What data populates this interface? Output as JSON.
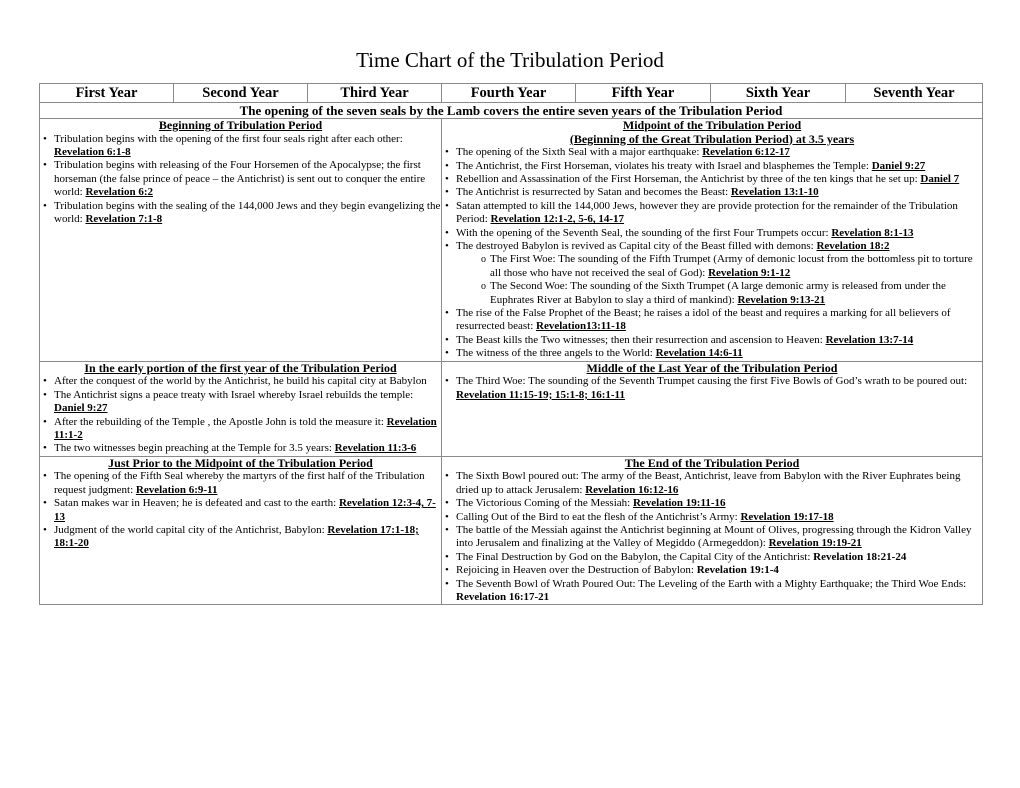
{
  "title": "Time Chart of the Tribulation Period",
  "years": [
    "First Year",
    "Second Year",
    "Third Year",
    "Fourth Year",
    "Fifth Year",
    "Sixth Year",
    "Seventh Year"
  ],
  "banner": "The opening of the seven seals by the Lamb covers the entire seven years of the Tribulation Period",
  "beginning": {
    "heading": "Beginning of Tribulation Period",
    "items": [
      {
        "text": "Tribulation begins with the opening of the first four seals right after each other: ",
        "ref": "Revelation 6:1-8"
      },
      {
        "text": "Tribulation begins with releasing of the Four Horsemen of the Apocalypse; the first horseman (the false prince of peace – the Antichrist) is sent out to conquer the entire world: ",
        "ref": "Revelation 6:2"
      },
      {
        "text": "Tribulation begins with the sealing of the 144,000 Jews and they begin evangelizing the world: ",
        "ref": "Revelation 7:1-8"
      }
    ]
  },
  "midpoint": {
    "heading": "Midpoint of the Tribulation Period",
    "subheading": "(Beginning of the Great Tribulation Period) at 3.5 years",
    "items": [
      {
        "text": "The opening of the Sixth Seal with a major earthquake: ",
        "ref": "Revelation 6:12-17"
      },
      {
        "text": "The Antichrist, the First Horseman, violates his treaty with Israel and blasphemes the Temple: ",
        "ref": "Daniel 9:27"
      },
      {
        "text": "Rebellion and Assassination of the First Horseman, the Antichrist by three of the ten kings that he set up: ",
        "ref": "Daniel 7"
      },
      {
        "text": "The Antichrist is resurrected by Satan and becomes the Beast: ",
        "ref": "Revelation 13:1-10"
      },
      {
        "text": "Satan attempted to kill the 144,000 Jews, however they are provide protection for the remainder of the Tribulation Period: ",
        "ref": "Revelation 12:1-2, 5-6, 14-17"
      },
      {
        "text": "With the opening of the Seventh Seal, the sounding of the first Four Trumpets occur: ",
        "ref": "Revelation 8:1-13"
      },
      {
        "text": "The destroyed Babylon is revived as Capital city of the Beast filled with demons: ",
        "ref": "Revelation 18:2"
      },
      {
        "sub": true,
        "text": "The First Woe: The sounding of the Fifth Trumpet (Army of demonic locust from the bottomless pit to torture all those who have not received the seal of God): ",
        "ref": "Revelation 9:1-12"
      },
      {
        "sub": true,
        "text": "The Second Woe: The sounding of the Sixth Trumpet (A large demonic army is released from under the Euphrates River at Babylon to slay a third of mankind): ",
        "ref": "Revelation 9:13-21"
      },
      {
        "text": "The rise of the False Prophet of the Beast; he raises a idol of the beast and requires a marking for all believers of resurrected beast: ",
        "ref": "Revelation13:11-18"
      },
      {
        "text": "The Beast kills the Two witnesses; then their resurrection and ascension to Heaven: ",
        "ref": "Revelation 13:7-14"
      },
      {
        "text": "The witness of the three angels to the World: ",
        "ref": "Revelation 14:6-11"
      }
    ]
  },
  "early": {
    "heading": "In the early portion of the first year of the Tribulation Period",
    "items": [
      {
        "text": "After the conquest of the world by the Antichrist, he build his capital city at Babylon",
        "ref": ""
      },
      {
        "text": "The Antichrist signs a peace treaty with Israel whereby Israel rebuilds the temple: ",
        "ref": "Daniel 9:27"
      },
      {
        "text": "After the rebuilding of the Temple , the Apostle John is told the measure it: ",
        "ref": "Revelation 11:1-2"
      },
      {
        "text": "The two witnesses begin preaching at the Temple for 3.5 years: ",
        "ref": "Revelation 11:3-6"
      }
    ]
  },
  "lastyear": {
    "heading": "Middle of the Last Year of the Tribulation Period",
    "items": [
      {
        "text": "The Third Woe: The sounding of the Seventh Trumpet causing the first Five Bowls of God’s wrath to be poured out: ",
        "ref": "Revelation 11:15-19; 15:1-8; 16:1-11"
      }
    ]
  },
  "prior": {
    "heading": "Just Prior to the Midpoint of the Tribulation Period",
    "items": [
      {
        "text": "The opening of the Fifth Seal whereby the martyrs of the first half of the Tribulation request judgment: ",
        "ref": "Revelation 6:9-11"
      },
      {
        "text": "Satan makes war in Heaven; he is defeated and cast to the earth: ",
        "ref": "Revelation 12:3-4, 7-13"
      },
      {
        "text": "Judgment of the world capital city of the Antichrist, Babylon: ",
        "ref": "Revelation 17:1-18; 18:1-20"
      }
    ]
  },
  "end": {
    "heading": "The End of the Tribulation Period",
    "items": [
      {
        "text": "The Sixth Bowl poured out: The army of the Beast, Antichrist, leave from Babylon with the River Euphrates being dried up to attack Jerusalem: ",
        "ref": "Revelation 16:12-16"
      },
      {
        "text": "The Victorious Coming of the Messiah: ",
        "ref": "Revelation 19:11-16"
      },
      {
        "text": "Calling Out of the Bird to eat the flesh of the Antichrist’s Army: ",
        "ref": "Revelation 19:17-18"
      },
      {
        "text": "The battle of the Messiah against the Antichrist beginning at Mount of Olives, progressing through the Kidron Valley into Jerusalem and finalizing at the Valley of Megiddo (Armegeddon): ",
        "ref": "Revelation 19:19-21"
      },
      {
        "text": "The Final Destruction by God on the Babylon, the Capital City of the Antichrist: ",
        "ref": "Revelation 18:21-24",
        "plain": true
      },
      {
        "text": "Rejoicing in Heaven over the Destruction of Babylon: ",
        "ref": "Revelation 19:1-4",
        "plain": true
      },
      {
        "text": "The Seventh Bowl of Wrath Poured Out: The Leveling of the Earth with a Mighty Earthquake; the Third Woe Ends: ",
        "ref": "Revelation 16:17-21",
        "plain": true
      }
    ]
  }
}
